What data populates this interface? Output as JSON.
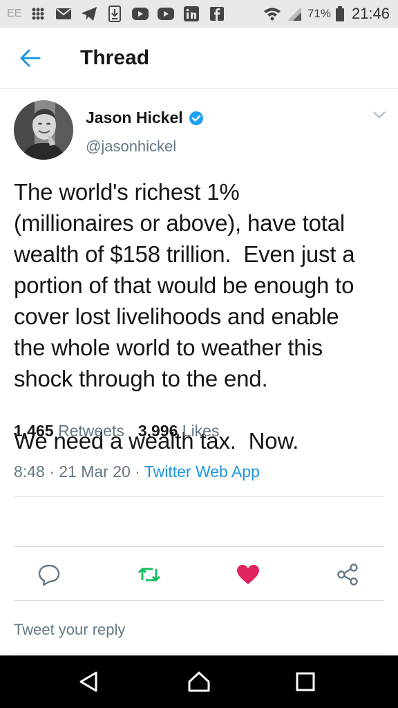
{
  "status_bar": {
    "carrier": "EE",
    "battery_percent": "71%",
    "time": "21:46",
    "icons": [
      "grid-icon",
      "mail-icon",
      "telegram-icon",
      "download-icon",
      "youtube-icon",
      "youtube-icon",
      "linkedin-icon",
      "facebook-icon",
      "wifi-icon",
      "signal-icon",
      "battery-icon"
    ]
  },
  "header": {
    "title": "Thread"
  },
  "tweet": {
    "author_name": "Jason Hickel",
    "author_handle": "@jasonhickel",
    "verified": true,
    "text": "The world's richest 1%\n(millionaires or above), have total\nwealth of $158 trillion.  Even just a\nportion of that would be enough to\ncover lost livelihoods and enable\nthe whole world to weather this\nshock through to the end.\n\nWe need a wealth tax.  Now.",
    "time": "8:48",
    "date": "21 Mar 20",
    "separator": "·",
    "source": "Twitter Web App",
    "retweets_count": "1,465",
    "retweets_label": "Retweets",
    "likes_count": "3,996",
    "likes_label": "Likes"
  },
  "reply": {
    "placeholder": "Tweet your reply"
  },
  "colors": {
    "accent": "#1b95e0",
    "retweet": "#17bf63",
    "like": "#e0245e",
    "muted": "#657786"
  }
}
